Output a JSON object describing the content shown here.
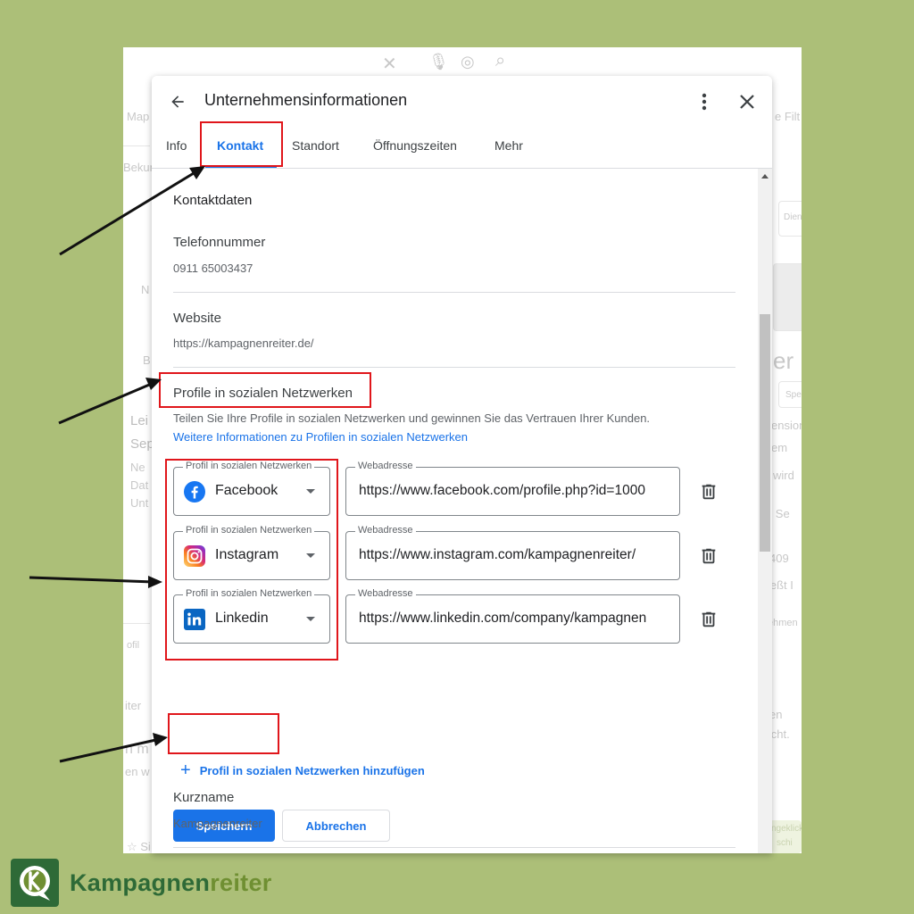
{
  "background_partial": {
    "texts": [
      "Map",
      "Bekun",
      "N",
      "B",
      "Lei",
      "Sep",
      "Ne",
      "Dat",
      "Unt",
      "ofil",
      "iter",
      "n m",
      "en w",
      "☆ Si",
      "e Filt",
      "Dienst",
      "er",
      "Sper",
      "ension",
      "em",
      "wird",
      "e · Se",
      "409",
      "ießt I",
      "ehmen",
      "en",
      "licht.",
      "ngeklickt",
      "schi"
    ]
  },
  "dialog": {
    "title": "Unternehmensinformationen",
    "tabs": [
      {
        "label": "Info"
      },
      {
        "label": "Kontakt"
      },
      {
        "label": "Standort"
      },
      {
        "label": "Öffnungszeiten"
      },
      {
        "label": "Mehr"
      }
    ],
    "active_tab": "Kontakt",
    "contact_section_title": "Kontaktdaten",
    "phone": {
      "label": "Telefonnummer",
      "value": "0911 65003437"
    },
    "website": {
      "label": "Website",
      "value": "https://kampagnenreiter.de/"
    },
    "social": {
      "title": "Profile in sozialen Netzwerken",
      "help_text": "Teilen Sie Ihre Profile in sozialen Netzwerken und gewinnen Sie das Vertrauen Ihrer Kunden.",
      "help_link": "Weitere Informationen zu Profilen in sozialen Netzwerken",
      "profile_field_label": "Profil in sozialen Netzwerken",
      "url_field_label": "Webadresse",
      "profiles": [
        {
          "network": "Facebook",
          "icon": "facebook-icon",
          "url": "https://www.facebook.com/profile.php?id=1000"
        },
        {
          "network": "Instagram",
          "icon": "instagram-icon",
          "url": "https://www.instagram.com/kampagnenreiter/"
        },
        {
          "network": "Linkedin",
          "icon": "linkedin-icon",
          "url": "https://www.linkedin.com/company/kampagnen"
        }
      ],
      "add_label": "Profil in sozialen Netzwerken hinzufügen"
    },
    "save_label": "Speichern",
    "cancel_label": "Abbrechen",
    "shortname": {
      "label": "Kurzname",
      "value": "Kampagnenreiter"
    }
  },
  "brand": {
    "part1": "Kampagnen",
    "part2": "reiter",
    "colors": {
      "dark": "#2e6a37",
      "light": "#6f8f32"
    }
  },
  "colors": {
    "page_bg": "#acbf78",
    "accent": "#1a73e8",
    "highlight": "#e0161b"
  }
}
